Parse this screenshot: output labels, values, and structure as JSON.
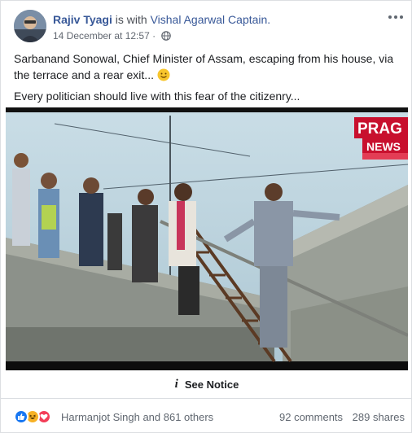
{
  "post": {
    "author": "Rajiv Tyagi",
    "with_text": "is with",
    "tagged": "Vishal Agarwal Captain.",
    "timestamp": "14 December at 12:57",
    "audience_icon": "globe-icon",
    "caption_line1": "Sarbanand Sonowal, Chief Minister of Assam, escaping from his house, via the terrace and a rear exit...",
    "caption_emoji": "slightly-smiling-face-emoji",
    "caption_line2": "Every politician should live with this fear of the citizenry...",
    "media": {
      "channel_logo_line1": "PRAG",
      "channel_logo_line2": "NEWS"
    },
    "notice": {
      "icon": "info-icon",
      "label": "See Notice"
    },
    "footer": {
      "reactions": [
        "like-reaction-icon",
        "haha-reaction-icon",
        "love-reaction-icon"
      ],
      "reactors_text": "Harmanjot Singh and 861 others",
      "comments": "92 comments",
      "shares": "289 shares"
    },
    "colors": {
      "link": "#385898",
      "like": "#1877f2",
      "love": "#f33e58",
      "haha": "#f7b125",
      "news_red": "#c8102e"
    }
  }
}
